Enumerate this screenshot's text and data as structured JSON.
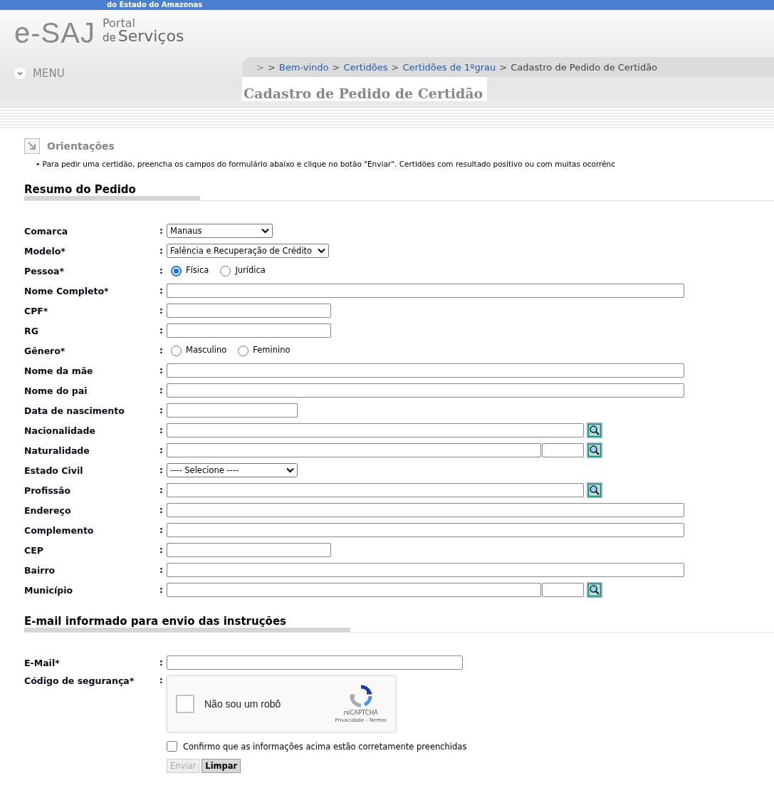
{
  "top_banner": {
    "text": "do Estado do Amazonas"
  },
  "logo": {
    "brand": "e-SAJ",
    "line1": "Portal",
    "line2_small": "de",
    "line2": "Serviços"
  },
  "breadcrumb_lead": ">",
  "breadcrumb": [
    {
      "separator": ">",
      "label": "Bem-vindo",
      "link": true
    },
    {
      "separator": ">",
      "label": "Certidões",
      "link": true
    },
    {
      "separator": ">",
      "label": "Certidões de 1ºgrau",
      "link": true
    },
    {
      "separator": ">",
      "label": "Cadastro de Pedido de Certidão",
      "link": false
    }
  ],
  "menu": {
    "label": "MENU"
  },
  "page_title": "Cadastro de Pedido de Certidão",
  "guidance": {
    "title": "Orientações",
    "bullet": "•",
    "items": [
      "Para pedir uma certidão, preencha os campos do formulário abaixo e clique no botão \"Enviar\". Certidões com resultado positivo ou com muitas ocorrênc"
    ]
  },
  "field_separator": ":",
  "sections": [
    {
      "title": "Resumo do Pedido",
      "fields": [
        {
          "label": "Comarca",
          "kind": "select",
          "value": "Manaus"
        },
        {
          "label": "Modelo*",
          "kind": "select-wide",
          "value": "Falência e Recuperação de Crédito"
        },
        {
          "label": "Pessoa*",
          "kind": "radio",
          "options": [
            {
              "label": "Física",
              "selected": true
            },
            {
              "label": "Jurídica",
              "selected": false
            }
          ]
        },
        {
          "label": "Nome Completo*",
          "kind": "text"
        },
        {
          "label": "CPF*",
          "kind": "code"
        },
        {
          "label": "RG",
          "kind": "code"
        },
        {
          "label": "Gênero*",
          "kind": "radio",
          "options": [
            {
              "label": "Masculino",
              "selected": false
            },
            {
              "label": "Feminino",
              "selected": false
            }
          ]
        },
        {
          "label": "Nome da mãe",
          "kind": "text"
        },
        {
          "label": "Nome do pai",
          "kind": "text"
        },
        {
          "label": "Data de nascimento",
          "kind": "date"
        },
        {
          "label": "Nacionalidade",
          "kind": "lookup"
        },
        {
          "label": "Naturalidade",
          "kind": "lookup-pair"
        },
        {
          "label": "Estado Civil",
          "kind": "select-medium",
          "value": "---- Selecione ----"
        },
        {
          "label": "Profissão",
          "kind": "lookup"
        },
        {
          "label": "Endereço",
          "kind": "text"
        },
        {
          "label": "Complemento",
          "kind": "text"
        },
        {
          "label": "CEP",
          "kind": "code"
        },
        {
          "label": "Bairro",
          "kind": "text"
        },
        {
          "label": "Município",
          "kind": "lookup-pair"
        }
      ]
    },
    {
      "title": "E-mail informado para envio das instruções",
      "fields": [
        {
          "label": "E-Mail*",
          "kind": "email"
        },
        {
          "label": "Código de segurança*",
          "kind": "captcha",
          "captcha": {
            "checked": false,
            "label": "Não sou um robô",
            "brand": "reCAPTCHA",
            "links": "Privacidade - Termos"
          }
        }
      ]
    }
  ],
  "confirm": {
    "label": "Confirmo que as informações acima estão corretamente preenchidas",
    "checked": false
  },
  "buttons": [
    {
      "label": "Enviar",
      "disabled": true
    },
    {
      "label": "Limpar",
      "disabled": false
    }
  ]
}
